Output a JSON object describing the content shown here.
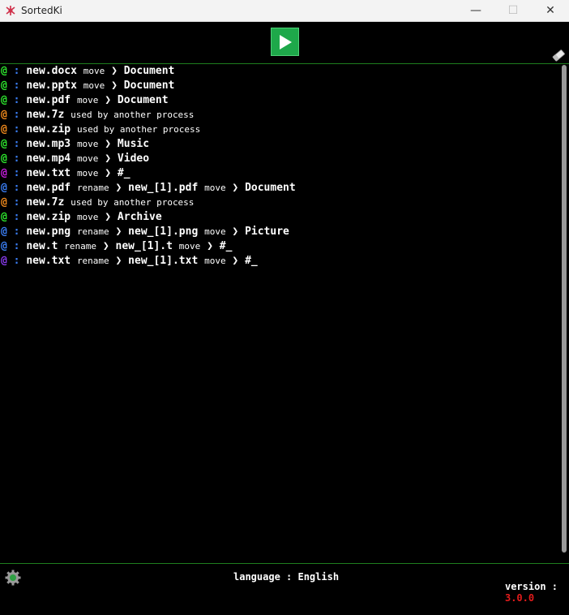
{
  "window": {
    "title": "SortedKi",
    "controls": {
      "minimize": "—",
      "maximize": "☐",
      "close": "✕"
    }
  },
  "toolbar": {
    "run_icon": "play-icon",
    "clear_icon": "eraser-icon"
  },
  "log": [
    {
      "at_color": "#2ee62e",
      "at": "@",
      "sep": ":",
      "parts": [
        {
          "t": "fname",
          "v": "new.docx"
        },
        {
          "t": "action",
          "v": "move"
        },
        {
          "t": "arrow",
          "v": "❯"
        },
        {
          "t": "target",
          "v": "Document"
        }
      ]
    },
    {
      "at_color": "#2ee62e",
      "at": "@",
      "sep": ":",
      "parts": [
        {
          "t": "fname",
          "v": "new.pptx"
        },
        {
          "t": "action",
          "v": "move"
        },
        {
          "t": "arrow",
          "v": "❯"
        },
        {
          "t": "target",
          "v": "Document"
        }
      ]
    },
    {
      "at_color": "#2ee62e",
      "at": "@",
      "sep": ":",
      "parts": [
        {
          "t": "fname",
          "v": "new.pdf"
        },
        {
          "t": "action",
          "v": "move"
        },
        {
          "t": "arrow",
          "v": "❯"
        },
        {
          "t": "target",
          "v": "Document"
        }
      ]
    },
    {
      "at_color": "#f08a1c",
      "at": "@",
      "sep": ":",
      "parts": [
        {
          "t": "fname",
          "v": "new.7z"
        },
        {
          "t": "action",
          "v": "used by another process"
        }
      ]
    },
    {
      "at_color": "#f08a1c",
      "at": "@",
      "sep": ":",
      "parts": [
        {
          "t": "fname",
          "v": "new.zip"
        },
        {
          "t": "action",
          "v": "used by another process"
        }
      ]
    },
    {
      "at_color": "#2ee62e",
      "at": "@",
      "sep": ":",
      "parts": [
        {
          "t": "fname",
          "v": "new.mp3"
        },
        {
          "t": "action",
          "v": "move"
        },
        {
          "t": "arrow",
          "v": "❯"
        },
        {
          "t": "target",
          "v": "Music"
        }
      ]
    },
    {
      "at_color": "#2ee62e",
      "at": "@",
      "sep": ":",
      "parts": [
        {
          "t": "fname",
          "v": "new.mp4"
        },
        {
          "t": "action",
          "v": "move"
        },
        {
          "t": "arrow",
          "v": "❯"
        },
        {
          "t": "target",
          "v": "Video"
        }
      ]
    },
    {
      "at_color": "#c81fe0",
      "at": "@",
      "sep": ":",
      "parts": [
        {
          "t": "fname",
          "v": "new.txt"
        },
        {
          "t": "action",
          "v": "move"
        },
        {
          "t": "arrow",
          "v": "❯"
        },
        {
          "t": "target",
          "v": "#_"
        }
      ]
    },
    {
      "at_color": "#3b7ff5",
      "at": "@",
      "sep": ":",
      "parts": [
        {
          "t": "fname",
          "v": "new.pdf"
        },
        {
          "t": "action",
          "v": "rename"
        },
        {
          "t": "arrow",
          "v": "❯"
        },
        {
          "t": "target",
          "v": "new_[1].pdf"
        },
        {
          "t": "action",
          "v": "move"
        },
        {
          "t": "arrow",
          "v": "❯"
        },
        {
          "t": "target",
          "v": "Document"
        }
      ]
    },
    {
      "at_color": "#f08a1c",
      "at": "@",
      "sep": ":",
      "parts": [
        {
          "t": "fname",
          "v": "new.7z"
        },
        {
          "t": "action",
          "v": "used by another process"
        }
      ]
    },
    {
      "at_color": "#2ee62e",
      "at": "@",
      "sep": ":",
      "parts": [
        {
          "t": "fname",
          "v": "new.zip"
        },
        {
          "t": "action",
          "v": "move"
        },
        {
          "t": "arrow",
          "v": "❯"
        },
        {
          "t": "target",
          "v": "Archive"
        }
      ]
    },
    {
      "at_color": "#3b7ff5",
      "at": "@",
      "sep": ":",
      "parts": [
        {
          "t": "fname",
          "v": "new.png"
        },
        {
          "t": "action",
          "v": "rename"
        },
        {
          "t": "arrow",
          "v": "❯"
        },
        {
          "t": "target",
          "v": "new_[1].png"
        },
        {
          "t": "action",
          "v": "move"
        },
        {
          "t": "arrow",
          "v": "❯"
        },
        {
          "t": "target",
          "v": "Picture"
        }
      ]
    },
    {
      "at_color": "#3b7ff5",
      "at": "@",
      "sep": ":",
      "parts": [
        {
          "t": "fname",
          "v": "new.t"
        },
        {
          "t": "action",
          "v": "rename"
        },
        {
          "t": "arrow",
          "v": "❯"
        },
        {
          "t": "target",
          "v": "new_[1].t"
        },
        {
          "t": "action",
          "v": "move"
        },
        {
          "t": "arrow",
          "v": "❯"
        },
        {
          "t": "target",
          "v": "#_"
        }
      ]
    },
    {
      "at_color": "#8a3cf0",
      "at": "@",
      "sep": ":",
      "parts": [
        {
          "t": "fname",
          "v": "new.txt"
        },
        {
          "t": "action",
          "v": "rename"
        },
        {
          "t": "arrow",
          "v": "❯"
        },
        {
          "t": "target",
          "v": "new_[1].txt"
        },
        {
          "t": "action",
          "v": "move"
        },
        {
          "t": "arrow",
          "v": "❯"
        },
        {
          "t": "target",
          "v": "#_"
        }
      ]
    }
  ],
  "status": {
    "settings_icon": "gear-icon",
    "language_label": "language : English",
    "version_label": "version :",
    "version_value": "3.0.0"
  }
}
